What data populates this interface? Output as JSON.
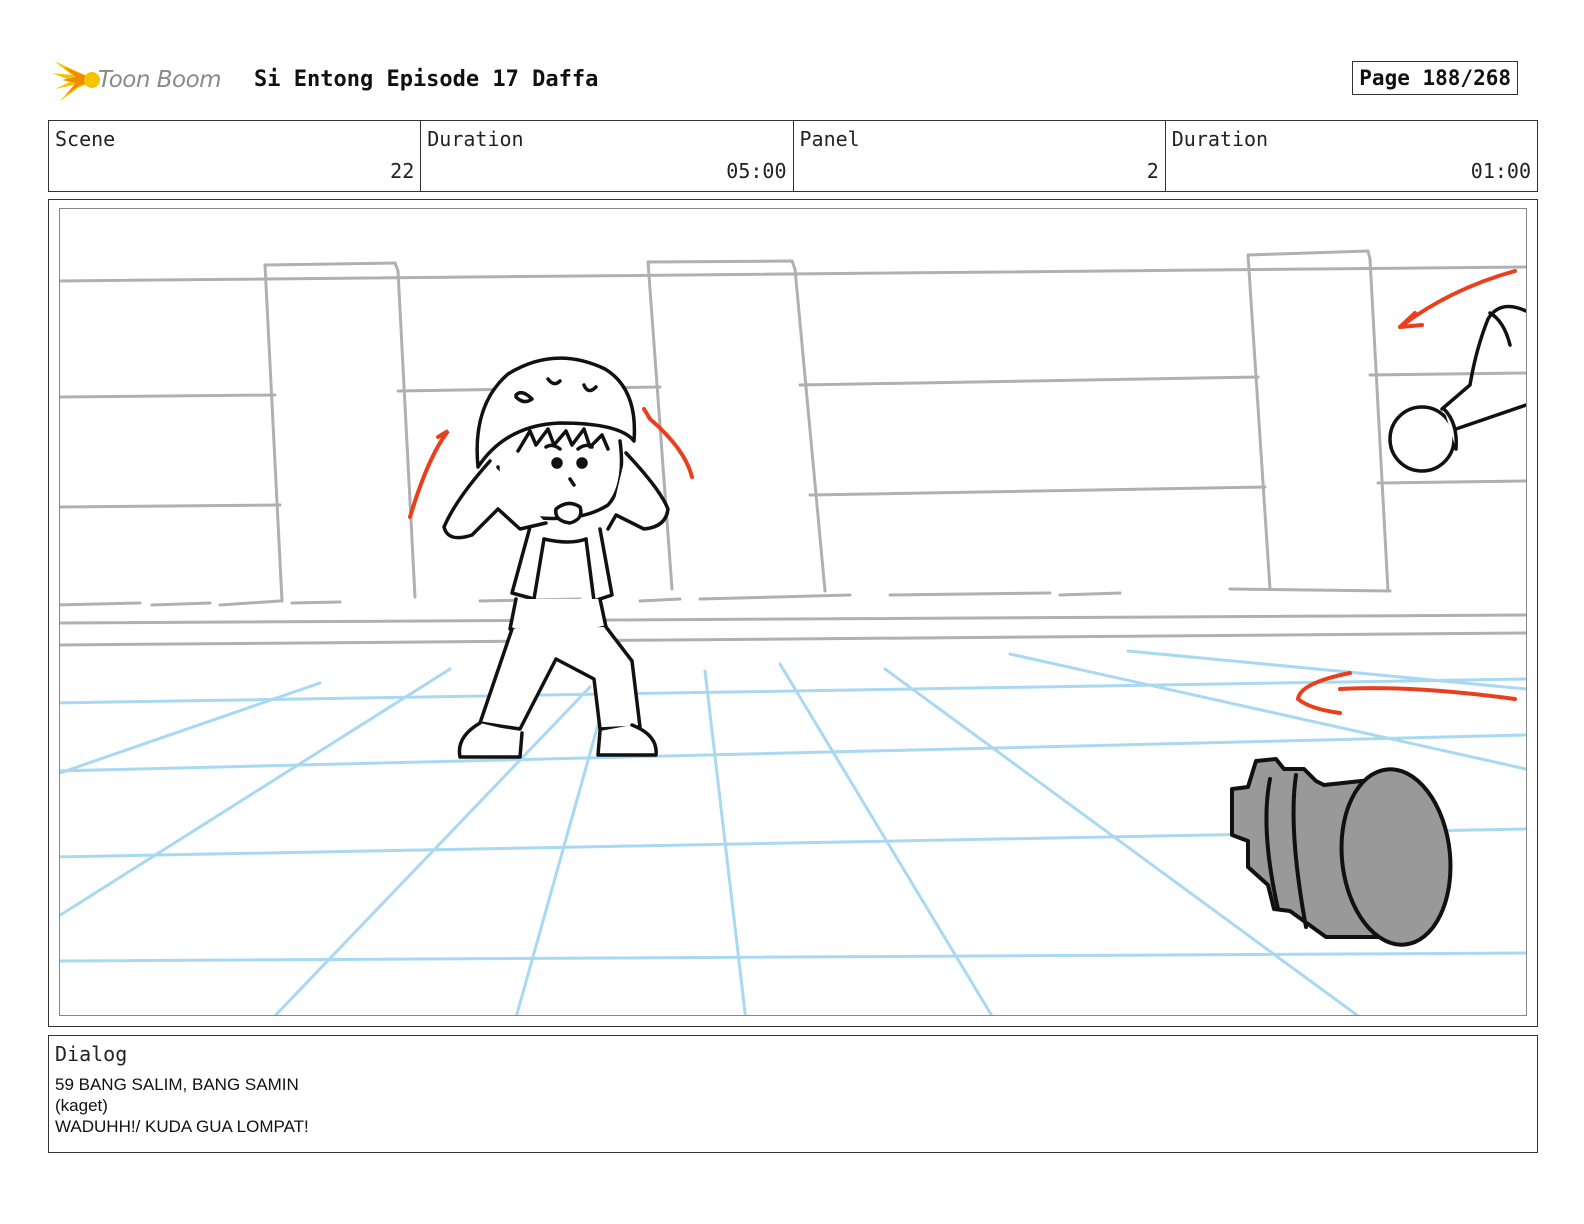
{
  "header": {
    "logo_text": "Toon Boom",
    "project_title": "Si Entong Episode 17 Daffa",
    "page_label": "Page 188/268"
  },
  "info": {
    "scene_label": "Scene",
    "scene_value": "22",
    "scene_duration_label": "Duration",
    "scene_duration_value": "05:00",
    "panel_label": "Panel",
    "panel_value": "2",
    "panel_duration_label": "Duration",
    "panel_duration_value": "01:00"
  },
  "dialog": {
    "label": "Dialog",
    "lines": [
      "59 BANG SALIM, BANG SAMIN",
      "(kaget)",
      "WADUHH!/ KUDA GUA LOMPAT!"
    ]
  },
  "colors": {
    "sketch_gray": "#b0b0b0",
    "floor_grid": "#a9d8f2",
    "action_red": "#e8401c",
    "ink": "#111111",
    "logo_yellow": "#f5c400"
  }
}
